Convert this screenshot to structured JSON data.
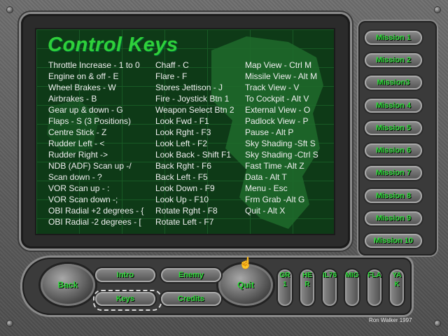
{
  "screen": {
    "title": "Control Keys",
    "col1": [
      "Throttle Increase - 1 to 0",
      "Engine on & off - E",
      "Wheel Brakes - W",
      "Airbrakes - B",
      "Gear up & down - G",
      "Flaps - S (3 Positions)",
      "Centre Stick - Z",
      "Rudder Left - <",
      "Rudder  Right ->",
      "NDB (ADF) Scan up -/",
      "Scan down - ?",
      "VOR Scan up - :",
      "VOR Scan down -;",
      "OBI Radial +2 degrees - {",
      "OBI Radial -2 degrees - ["
    ],
    "col2": [
      "Chaff - C",
      "Flare - F",
      "Stores Jettison - J",
      "Fire - Joystick Btn 1",
      "Weapon Select Btn 2",
      "Look Fwd - F1",
      "Look Rght - F3",
      "Look Left - F2",
      "Look Back - Shift F1",
      "Back Rght - F6",
      "Back Left - F5",
      "Look Down - F9",
      "Look Up - F10",
      "Rotate Rght - F8",
      "Rotate Left - F7"
    ],
    "col3": [
      "Map View - Ctrl M",
      "Missile View - Alt M",
      "Track View - V",
      "To Cockpit - Alt V",
      "External View - O",
      "Padlock View - P",
      "Pause - Alt P",
      "Sky Shading -Sft S",
      "Sky Shading -Ctrl S",
      "Fast Time -Alt Z",
      "Data - Alt T",
      "Menu - Esc",
      "Frm Grab -Alt G",
      "Quit - Alt X"
    ]
  },
  "missions": [
    "Mission 1",
    "Mission 2",
    "Mission3",
    "Mission 4",
    "Mission 5",
    "Mission 6",
    "Mission 7",
    "Mission 8",
    "Mission 9",
    "Mission 10"
  ],
  "console": {
    "back": "Back",
    "quit": "Quit",
    "intro": "Intro",
    "keys": "Keys",
    "enemy": "Enemy",
    "credits": "Credits",
    "aircraft": [
      "GR1",
      "HER",
      "IL76",
      "MIG",
      "FLA",
      "YAK"
    ]
  },
  "credit": "Ron Walker 1997",
  "colors": {
    "accent_green": "#2fdc3a",
    "screen_green": "#0e3a17",
    "text": "#f0f0f0"
  }
}
